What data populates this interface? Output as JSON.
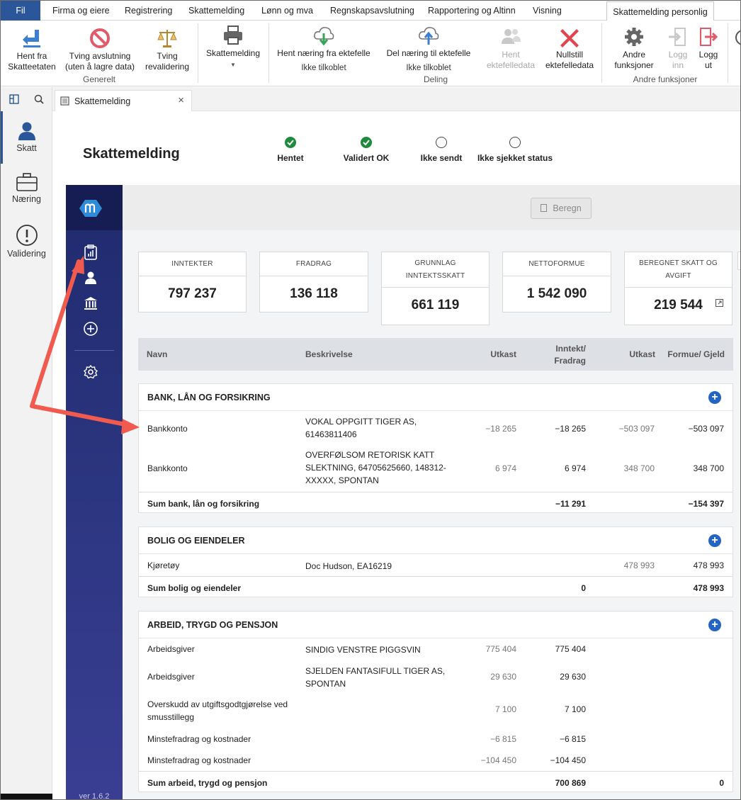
{
  "menu": {
    "items": [
      "Fil",
      "Firma og eiere",
      "Registrering",
      "Skattemelding",
      "Lønn og mva",
      "Regnskapsavslutning",
      "Rapportering og Altinn",
      "Visning",
      "Skattemelding personlig"
    ]
  },
  "ribbon": {
    "hent_fra": "Hent fra\nSkatteetaten",
    "tving_avslutning": "Tving avslutning\n(uten å lagre data)",
    "tving_revalidering": "Tving\nrevalidering",
    "skattemelding": "Skattemelding",
    "group_generelt": "Generelt",
    "hent_naering": "Hent næring fra ektefelle",
    "hent_naering_status": "Ikke tilkoblet",
    "del_naering": "Del næring til ektefelle",
    "del_naering_status": "Ikke tilkoblet",
    "hent_ektefelledata": "Hent\nektefelledata",
    "nullstill": "Nullstill\nektefelledata",
    "group_deling": "Deling",
    "andre_funksjoner": "Andre\nfunksjoner",
    "logg_inn": "Logg\ninn",
    "logg_ut": "Logg\nut",
    "group_andre": "Andre funksjoner"
  },
  "leftnav": {
    "skatt": "Skatt",
    "naering": "Næring",
    "validering": "Validering"
  },
  "doc_tab": {
    "label": "Skattemelding"
  },
  "page": {
    "title": "Skattemelding",
    "steps": [
      "Hentet",
      "Validert OK",
      "Ikke sendt",
      "Ikke sjekket status"
    ]
  },
  "app": {
    "beregn": "Beregn",
    "version": "ver 1.6.2"
  },
  "summary_cards": [
    {
      "label": "INNTEKTER",
      "value": "797 237"
    },
    {
      "label": "FRADRAG",
      "value": "136 118"
    },
    {
      "label": "GRUNNLAG INNTEKTSSKATT",
      "value": "661 119"
    },
    {
      "label": "NETTOFORMUE",
      "value": "1 542 090"
    },
    {
      "label": "BEREGNET SKATT OG AVGIFT",
      "value": "219 544"
    }
  ],
  "table_header": {
    "navn": "Navn",
    "beskrivelse": "Beskrivelse",
    "utkast1": "Utkast",
    "inntekt_fradrag": "Inntekt/\nFradrag",
    "utkast2": "Utkast",
    "formue_gjeld": "Formue/ Gjeld"
  },
  "sections": [
    {
      "title": "BANK, LÅN OG FORSIKRING",
      "rows": [
        {
          "navn": "Bankkonto",
          "beskrivelse": "VOKAL OPPGITT TIGER AS, 61463811406",
          "utkast1": "−18 265",
          "inntekt": "−18 265",
          "utkast2": "−503 097",
          "formue": "−503 097"
        },
        {
          "navn": "Bankkonto",
          "beskrivelse": "OVERFØLSOM RETORISK KATT SLEKTNING, 64705625660, 148312-XXXXX, SPONTAN",
          "utkast1": "6 974",
          "inntekt": "6 974",
          "utkast2": "348 700",
          "formue": "348 700"
        }
      ],
      "sum_label": "Sum bank, lån og forsikring",
      "sum_inntekt": "−11 291",
      "sum_formue": "−154 397"
    },
    {
      "title": "BOLIG OG EIENDELER",
      "rows": [
        {
          "navn": "Kjøretøy",
          "beskrivelse": "Doc Hudson, EA16219",
          "utkast1": "",
          "inntekt": "",
          "utkast2": "478 993",
          "formue": "478 993"
        }
      ],
      "sum_label": "Sum bolig og eiendeler",
      "sum_inntekt": "0",
      "sum_formue": "478 993"
    },
    {
      "title": "ARBEID, TRYGD OG PENSJON",
      "rows": [
        {
          "navn": "Arbeidsgiver",
          "beskrivelse": "SINDIG VENSTRE PIGGSVIN",
          "utkast1": "775 404",
          "inntekt": "775 404",
          "utkast2": "",
          "formue": ""
        },
        {
          "navn": "Arbeidsgiver",
          "beskrivelse": "SJELDEN FANTASIFULL TIGER AS, SPONTAN",
          "utkast1": "29 630",
          "inntekt": "29 630",
          "utkast2": "",
          "formue": ""
        },
        {
          "navn": "Overskudd av utgiftsgodtgjørelse ved smusstillegg",
          "beskrivelse": "",
          "utkast1": "7 100",
          "inntekt": "7 100",
          "utkast2": "",
          "formue": ""
        },
        {
          "navn": "Minstefradrag og kostnader",
          "beskrivelse": "",
          "utkast1": "−6 815",
          "inntekt": "−6 815",
          "utkast2": "",
          "formue": ""
        },
        {
          "navn": "Minstefradrag og kostnader",
          "beskrivelse": "",
          "utkast1": "−104 450",
          "inntekt": "−104 450",
          "utkast2": "",
          "formue": ""
        }
      ],
      "sum_label": "Sum arbeid, trygd og pensjon",
      "sum_inntekt": "700 869",
      "sum_formue": "0"
    }
  ],
  "colors": {
    "ribbon_accent": "#2b579a",
    "app_nav": "#1f2a6e",
    "ok_green": "#1e8a3b",
    "plus_blue": "#2563c4",
    "arrow_red": "#f05a4f"
  }
}
